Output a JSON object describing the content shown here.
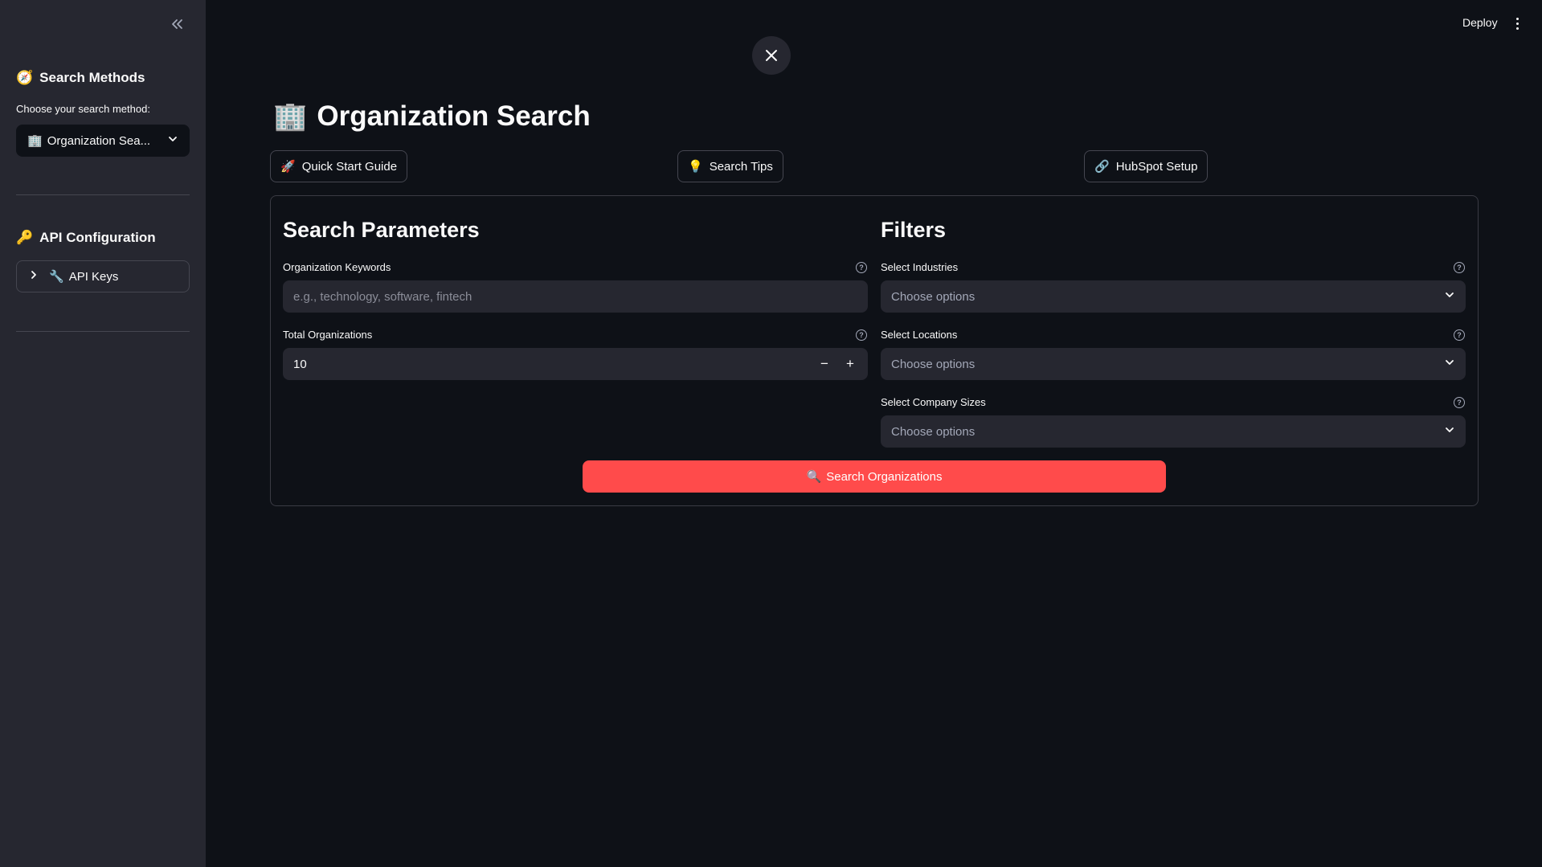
{
  "sidebar": {
    "collapse_icon": "double-chevron-left-icon",
    "search_methods": {
      "emoji": "🧭",
      "title": "Search Methods"
    },
    "choose_label": "Choose your search method:",
    "method_select": {
      "emoji": "🏢",
      "value": "Organization Sea..."
    },
    "api_config": {
      "emoji": "🔑",
      "title": "API Configuration"
    },
    "api_keys": {
      "emoji": "🔧",
      "label": "API Keys"
    }
  },
  "header": {
    "deploy_label": "Deploy"
  },
  "main": {
    "title_emoji": "🏢",
    "title": "Organization Search",
    "buttons": {
      "quick_start": {
        "emoji": "🚀",
        "label": "Quick Start Guide"
      },
      "search_tips": {
        "emoji": "💡",
        "label": "Search Tips"
      },
      "hubspot": {
        "emoji": "🔗",
        "label": "HubSpot Setup"
      }
    },
    "params": {
      "title": "Search Parameters",
      "keywords_label": "Organization Keywords",
      "keywords_placeholder": "e.g., technology, software, fintech",
      "total_label": "Total Organizations",
      "total_value": "10",
      "minus": "−",
      "plus": "+"
    },
    "filters": {
      "title": "Filters",
      "industries_label": "Select Industries",
      "locations_label": "Select Locations",
      "sizes_label": "Select Company Sizes",
      "placeholder": "Choose options"
    },
    "search_button": {
      "emoji": "🔍",
      "label": "Search Organizations"
    }
  },
  "colors": {
    "accent": "#ff4b4b",
    "background": "#0e1117",
    "sidebar": "#262730"
  }
}
